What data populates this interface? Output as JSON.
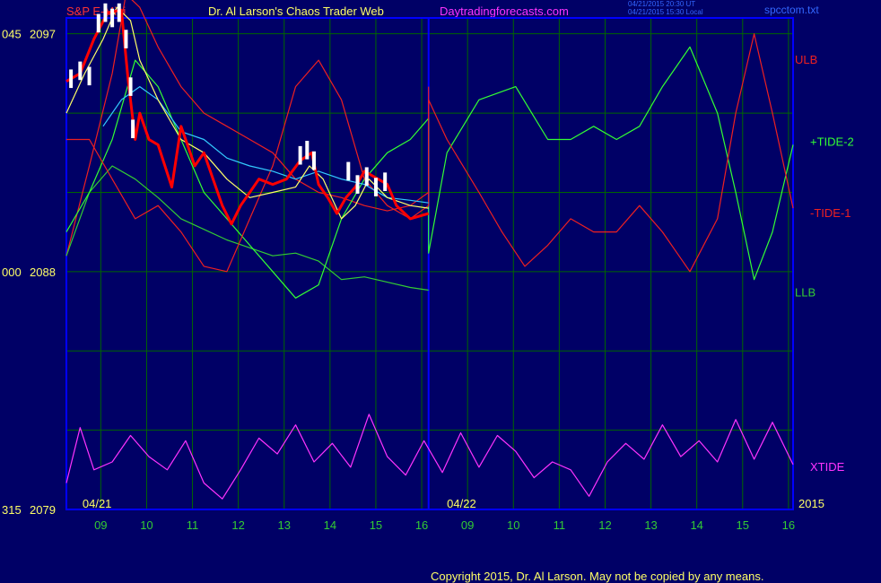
{
  "header": {
    "symbol": "S&P E-Mini",
    "title": "Dr. Al Larson's Chaos Trader Web",
    "site": "Daytradingforecasts.com",
    "stamp_ut": "04/21/2015 20:30 UT",
    "stamp_local": "04/21/2015 15:30 Local",
    "file": "spcctom.txt"
  },
  "colors": {
    "background": "#000066",
    "frame": "#0000ff",
    "grid": "#006600",
    "header_red": "#ff3333",
    "header_yellow": "#ffff66",
    "header_magenta": "#ff33ff",
    "price_red": "#ff0000",
    "price_white": "#ffffff",
    "ulb": "#ee2020",
    "llb": "#33cc33",
    "tide_plus": "#33ff33",
    "tide_minus": "#ee2020",
    "xtide": "#ff33ff",
    "cyan": "#33ccff",
    "yellow": "#ffff66"
  },
  "chart_data": {
    "type": "line",
    "title": "S&P E-Mini",
    "ylim": [
      2079,
      2097.6
    ],
    "y_ticks": [
      {
        "value": 2097,
        "label": "2097",
        "prefix": "045"
      },
      {
        "value": 2088,
        "label": "2088",
        "prefix": "000"
      },
      {
        "value": 2079,
        "label": "2079",
        "prefix": "315"
      }
    ],
    "x_hours": [
      "09",
      "10",
      "11",
      "12",
      "13",
      "14",
      "15",
      "16",
      "09",
      "10",
      "11",
      "12",
      "13",
      "14",
      "15",
      "16"
    ],
    "x_hour_positions": [
      0.75,
      1.75,
      2.75,
      3.75,
      4.75,
      5.75,
      6.75,
      7.75,
      8.75,
      9.75,
      10.75,
      11.75,
      12.75,
      13.75,
      14.75,
      15.75
    ],
    "dates": [
      {
        "label": "04/21",
        "x": 0.35
      },
      {
        "label": "04/22",
        "x": 8.3
      }
    ],
    "year_label": "2015",
    "xlim": [
      0,
      15.85
    ],
    "divider_x": 7.9,
    "series": [
      {
        "name": "ULB",
        "color_key": "ulb",
        "label_y": 2096,
        "points": [
          [
            0,
            2088.6
          ],
          [
            0.5,
            2092
          ],
          [
            1,
            2095.5
          ],
          [
            1.3,
            2098.5
          ],
          [
            1.6,
            2098
          ],
          [
            2,
            2096.5
          ],
          [
            2.5,
            2095
          ],
          [
            3,
            2094
          ],
          [
            3.5,
            2093.5
          ],
          [
            4,
            2093
          ],
          [
            4.5,
            2092.5
          ],
          [
            5,
            2091.5
          ],
          [
            5.5,
            2091
          ],
          [
            6,
            2090.8
          ],
          [
            6.5,
            2090.5
          ],
          [
            7,
            2090.3
          ],
          [
            7.5,
            2090.5
          ],
          [
            7.9,
            2091
          ],
          [
            7.9,
            2095
          ]
        ]
      },
      {
        "name": "LLB",
        "color_key": "llb",
        "label_y": 2087.2,
        "points": [
          [
            0,
            2088.6
          ],
          [
            0.5,
            2091
          ],
          [
            1,
            2092
          ],
          [
            1.5,
            2091.5
          ],
          [
            2,
            2090.8
          ],
          [
            2.5,
            2090
          ],
          [
            3,
            2089.6
          ],
          [
            3.5,
            2089.2
          ],
          [
            4,
            2088.9
          ],
          [
            4.5,
            2088.6
          ],
          [
            5,
            2088.7
          ],
          [
            5.5,
            2088.4
          ],
          [
            6,
            2087.7
          ],
          [
            6.5,
            2087.8
          ],
          [
            7,
            2087.6
          ],
          [
            7.5,
            2087.4
          ],
          [
            7.9,
            2087.3
          ]
        ]
      },
      {
        "name": "+TIDE-2",
        "color_key": "tide_plus",
        "label_y": 2092.9,
        "points": [
          [
            0,
            2089.5
          ],
          [
            0.5,
            2091
          ],
          [
            1,
            2093
          ],
          [
            1.5,
            2096
          ],
          [
            2,
            2095
          ],
          [
            2.5,
            2093
          ],
          [
            3,
            2091
          ],
          [
            3.5,
            2090
          ],
          [
            4,
            2089
          ],
          [
            4.5,
            2088
          ],
          [
            5,
            2087
          ],
          [
            5.5,
            2087.5
          ],
          [
            6,
            2090
          ],
          [
            6.5,
            2091.5
          ],
          [
            7,
            2092.5
          ],
          [
            7.5,
            2093
          ],
          [
            7.9,
            2093.8
          ],
          [
            7.9,
            2088.7
          ],
          [
            8.3,
            2092.5
          ],
          [
            9,
            2094.5
          ],
          [
            9.8,
            2095
          ],
          [
            10.5,
            2093
          ],
          [
            11,
            2093
          ],
          [
            11.5,
            2093.5
          ],
          [
            12,
            2093
          ],
          [
            12.5,
            2093.5
          ],
          [
            13,
            2095
          ],
          [
            13.6,
            2096.5
          ],
          [
            14.2,
            2094
          ],
          [
            14.6,
            2091
          ],
          [
            15,
            2087.7
          ],
          [
            15.4,
            2089.5
          ],
          [
            15.85,
            2092.8
          ]
        ]
      },
      {
        "name": "-TIDE-1",
        "color_key": "tide_minus",
        "label_y": 2090.2,
        "points": [
          [
            0,
            2093
          ],
          [
            0.5,
            2093
          ],
          [
            1,
            2091.5
          ],
          [
            1.5,
            2090
          ],
          [
            2,
            2090.5
          ],
          [
            2.5,
            2089.5
          ],
          [
            3,
            2088.2
          ],
          [
            3.5,
            2088
          ],
          [
            4,
            2090
          ],
          [
            4.5,
            2092
          ],
          [
            5,
            2095
          ],
          [
            5.5,
            2096
          ],
          [
            6,
            2094.5
          ],
          [
            6.5,
            2091.5
          ],
          [
            7,
            2090.5
          ],
          [
            7.5,
            2090
          ],
          [
            7.9,
            2090.5
          ],
          [
            7.9,
            2094.5
          ],
          [
            8.3,
            2093
          ],
          [
            9,
            2091
          ],
          [
            9.5,
            2089.5
          ],
          [
            10,
            2088.2
          ],
          [
            10.5,
            2089
          ],
          [
            11,
            2090
          ],
          [
            11.5,
            2089.5
          ],
          [
            12,
            2089.5
          ],
          [
            12.5,
            2090.5
          ],
          [
            13,
            2089.5
          ],
          [
            13.6,
            2088
          ],
          [
            14.2,
            2090
          ],
          [
            14.6,
            2094
          ],
          [
            15,
            2097
          ],
          [
            15.4,
            2094
          ],
          [
            15.85,
            2090.4
          ]
        ]
      },
      {
        "name": "XTIDE",
        "color_key": "xtide",
        "label_y": 2080.6,
        "points": [
          [
            0,
            2080
          ],
          [
            0.3,
            2082.1
          ],
          [
            0.6,
            2080.5
          ],
          [
            1,
            2080.8
          ],
          [
            1.4,
            2081.8
          ],
          [
            1.8,
            2081
          ],
          [
            2.2,
            2080.5
          ],
          [
            2.6,
            2081.6
          ],
          [
            3,
            2080
          ],
          [
            3.4,
            2079.4
          ],
          [
            3.8,
            2080.5
          ],
          [
            4.2,
            2081.7
          ],
          [
            4.6,
            2081.1
          ],
          [
            5,
            2082.2
          ],
          [
            5.4,
            2080.8
          ],
          [
            5.8,
            2081.5
          ],
          [
            6.2,
            2080.6
          ],
          [
            6.6,
            2082.6
          ],
          [
            7,
            2081
          ],
          [
            7.4,
            2080.3
          ],
          [
            7.8,
            2081.6
          ],
          [
            8.2,
            2080.4
          ],
          [
            8.6,
            2081.9
          ],
          [
            9,
            2080.6
          ],
          [
            9.4,
            2081.8
          ],
          [
            9.8,
            2081.2
          ],
          [
            10.2,
            2080.2
          ],
          [
            10.6,
            2080.8
          ],
          [
            11,
            2080.5
          ],
          [
            11.4,
            2079.5
          ],
          [
            11.8,
            2080.8
          ],
          [
            12.2,
            2081.5
          ],
          [
            12.6,
            2080.9
          ],
          [
            13,
            2082.2
          ],
          [
            13.4,
            2081
          ],
          [
            13.8,
            2081.6
          ],
          [
            14.2,
            2080.8
          ],
          [
            14.6,
            2082.4
          ],
          [
            15,
            2080.9
          ],
          [
            15.4,
            2082.3
          ],
          [
            15.85,
            2080.7
          ]
        ]
      },
      {
        "name": "",
        "color_key": "cyan",
        "points": [
          [
            0.8,
            2093.5
          ],
          [
            1.2,
            2094.5
          ],
          [
            1.6,
            2095
          ],
          [
            2,
            2094.5
          ],
          [
            2.5,
            2093.3
          ],
          [
            3,
            2093
          ],
          [
            3.5,
            2092.3
          ],
          [
            4,
            2092
          ],
          [
            4.5,
            2091.8
          ],
          [
            5,
            2091.5
          ],
          [
            5.5,
            2091.8
          ],
          [
            6,
            2091.5
          ],
          [
            6.5,
            2091.3
          ],
          [
            7,
            2090.8
          ],
          [
            7.5,
            2090.7
          ],
          [
            7.9,
            2090.6
          ]
        ]
      },
      {
        "name": "",
        "color_key": "yellow",
        "points": [
          [
            0,
            2094
          ],
          [
            0.4,
            2095.5
          ],
          [
            0.8,
            2096.8
          ],
          [
            1.1,
            2098
          ],
          [
            1.4,
            2097.5
          ],
          [
            1.6,
            2096
          ],
          [
            2,
            2094.5
          ],
          [
            2.5,
            2093
          ],
          [
            3,
            2092.5
          ],
          [
            3.5,
            2091.5
          ],
          [
            4,
            2090.8
          ],
          [
            4.5,
            2091
          ],
          [
            5,
            2091.2
          ],
          [
            5.3,
            2092
          ],
          [
            5.6,
            2091.5
          ],
          [
            6,
            2090
          ],
          [
            6.3,
            2090.5
          ],
          [
            6.6,
            2091.5
          ],
          [
            7,
            2090.8
          ],
          [
            7.5,
            2090.5
          ],
          [
            7.9,
            2090.4
          ]
        ]
      },
      {
        "name": "",
        "color_key": "price_red",
        "kind": "price",
        "points": [
          [
            0,
            2095.2
          ],
          [
            0.3,
            2095.5
          ],
          [
            0.6,
            2096.8
          ],
          [
            0.9,
            2097.8
          ],
          [
            1.2,
            2097.9
          ],
          [
            1.35,
            2095.2
          ],
          [
            1.5,
            2093
          ],
          [
            1.6,
            2094
          ],
          [
            1.8,
            2093
          ],
          [
            2,
            2092.8
          ],
          [
            2.3,
            2091.2
          ],
          [
            2.5,
            2093.5
          ],
          [
            2.8,
            2092
          ],
          [
            3,
            2092.5
          ],
          [
            3.2,
            2091.5
          ],
          [
            3.4,
            2090.5
          ],
          [
            3.6,
            2089.8
          ],
          [
            3.8,
            2090.5
          ],
          [
            4,
            2091
          ],
          [
            4.2,
            2091.5
          ],
          [
            4.5,
            2091.3
          ],
          [
            4.8,
            2091.5
          ],
          [
            5.1,
            2092.2
          ],
          [
            5.35,
            2092.5
          ],
          [
            5.5,
            2091.3
          ],
          [
            5.7,
            2090.8
          ],
          [
            5.9,
            2090.2
          ],
          [
            6.1,
            2090.8
          ],
          [
            6.3,
            2091.2
          ],
          [
            6.5,
            2091.8
          ],
          [
            6.8,
            2091.5
          ],
          [
            7,
            2091.3
          ],
          [
            7.2,
            2090.5
          ],
          [
            7.5,
            2090
          ],
          [
            7.9,
            2090.2
          ]
        ]
      },
      {
        "name": "",
        "color_key": "price_white",
        "kind": "bars",
        "points": [
          [
            0.1,
            2095.3
          ],
          [
            0.3,
            2095.6
          ],
          [
            0.5,
            2095.4
          ],
          [
            0.7,
            2097.4
          ],
          [
            0.85,
            2097.8
          ],
          [
            1,
            2097.6
          ],
          [
            1.15,
            2097.8
          ],
          [
            1.3,
            2096.8
          ],
          [
            1.4,
            2095
          ],
          [
            1.45,
            2093.4
          ],
          [
            5.1,
            2092.4
          ],
          [
            5.25,
            2092.6
          ],
          [
            5.4,
            2092.2
          ],
          [
            6.15,
            2091.8
          ],
          [
            6.35,
            2091.3
          ],
          [
            6.55,
            2091.6
          ],
          [
            6.75,
            2091.2
          ],
          [
            6.95,
            2091.4
          ]
        ]
      }
    ]
  },
  "legend_labels": {
    "ulb": "ULB",
    "tide_plus": "+TIDE-2",
    "tide_minus": "-TIDE-1",
    "llb": "LLB",
    "xtide": "XTIDE"
  },
  "footer": {
    "copyright": "Copyright 2015, Dr. Al Larson. May not be copied by any means."
  }
}
